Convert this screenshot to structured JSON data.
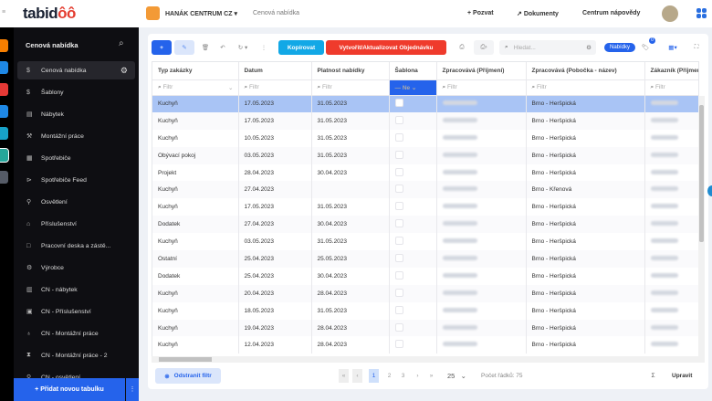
{
  "app": {
    "logo": "tabidoo",
    "workspace": "HANÁK CENTRUM CZ",
    "breadcrumb": "Cenová nabídka",
    "invite": "+ Pozvat",
    "documents": "Dokumenty",
    "help": "Centrum nápovědy"
  },
  "strip_colors": [
    "#f77f00",
    "#1e88e5",
    "#e53935",
    "#1e88e5",
    "#17a2c8",
    "#26a69a",
    "#555b66"
  ],
  "sidebar": {
    "title": "Cenová nabídka",
    "items": [
      {
        "icon": "$",
        "label": "Cenová nabídka",
        "active": true
      },
      {
        "icon": "$",
        "label": "Šablony"
      },
      {
        "icon": "▤",
        "label": "Nábytek"
      },
      {
        "icon": "⚒",
        "label": "Montážní práce"
      },
      {
        "icon": "▦",
        "label": "Spotřebiče"
      },
      {
        "icon": "⊳",
        "label": "Spotřebiče Feed"
      },
      {
        "icon": "⚲",
        "label": "Osvětlení"
      },
      {
        "icon": "⌂",
        "label": "Příslušenství"
      },
      {
        "icon": "□",
        "label": "Pracovní deska a zástě..."
      },
      {
        "icon": "⚙",
        "label": "Výrobce"
      },
      {
        "icon": "▥",
        "label": "CN - nábytek"
      },
      {
        "icon": "▣",
        "label": "CN - Příslušenství"
      },
      {
        "icon": "♁",
        "label": "CN - Montážní práce"
      },
      {
        "icon": "⧗",
        "label": "CN - Montážní práce - 2"
      },
      {
        "icon": "⚲",
        "label": "CN - osvětlení"
      }
    ],
    "add_label": "+ Přidat novou tabulku"
  },
  "toolbar": {
    "add": "+",
    "copy": "Kopírovat",
    "create_order": "Vytvořit/Aktualizovat Objednávku",
    "search_placeholder": "Hledat...",
    "tag": "Nabídky",
    "tag_count": "0"
  },
  "columns": [
    "Typ zakázky",
    "Datum",
    "Platnost nabídky",
    "Šablona",
    "Zpracovává (Příjmení)",
    "Zpracovává (Pobočka - název)",
    "Zákazník (Příjmení)"
  ],
  "filter_placeholder": "Filtr",
  "sablona_filter": "Ne",
  "rows": [
    [
      "Kuchyň",
      "17.05.2023",
      "31.05.2023",
      "Brno - Heršpická"
    ],
    [
      "Kuchyň",
      "17.05.2023",
      "31.05.2023",
      "Brno - Heršpická"
    ],
    [
      "Kuchyň",
      "10.05.2023",
      "31.05.2023",
      "Brno - Heršpická"
    ],
    [
      "Obývací pokoj",
      "03.05.2023",
      "31.05.2023",
      "Brno - Heršpická"
    ],
    [
      "Projekt",
      "28.04.2023",
      "30.04.2023",
      "Brno - Heršpická"
    ],
    [
      "Kuchyň",
      "27.04.2023",
      "",
      "Brno - Křenová"
    ],
    [
      "Kuchyň",
      "17.05.2023",
      "31.05.2023",
      "Brno - Heršpická"
    ],
    [
      "Dodatek",
      "27.04.2023",
      "30.04.2023",
      "Brno - Heršpická"
    ],
    [
      "Kuchyň",
      "03.05.2023",
      "31.05.2023",
      "Brno - Heršpická"
    ],
    [
      "Ostatní",
      "25.04.2023",
      "25.05.2023",
      "Brno - Heršpická"
    ],
    [
      "Dodatek",
      "25.04.2023",
      "30.04.2023",
      "Brno - Heršpická"
    ],
    [
      "Kuchyň",
      "20.04.2023",
      "28.04.2023",
      "Brno - Heršpická"
    ],
    [
      "Kuchyň",
      "18.05.2023",
      "31.05.2023",
      "Brno - Heršpická"
    ],
    [
      "Kuchyň",
      "19.04.2023",
      "28.04.2023",
      "Brno - Heršpická"
    ],
    [
      "Kuchyň",
      "12.04.2023",
      "28.04.2023",
      "Brno - Heršpická"
    ]
  ],
  "footer": {
    "remove_filter": "Odstranit filtr",
    "pages": [
      "1",
      "2",
      "3"
    ],
    "page_size": "25",
    "row_count": "Počet řádků: 75",
    "sum": "Σ",
    "edit": "Upravit"
  }
}
